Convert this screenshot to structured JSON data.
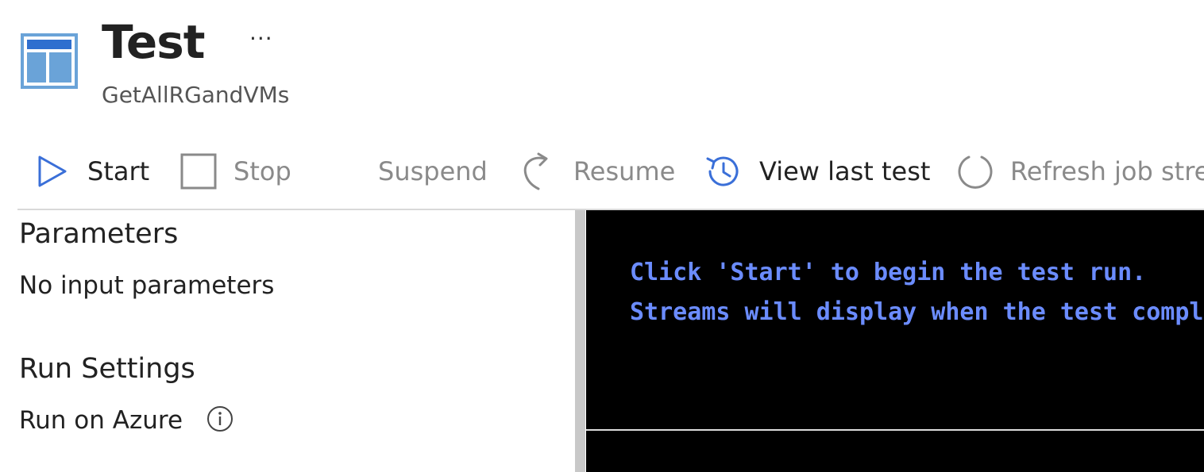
{
  "header": {
    "title": "Test",
    "more_label": "···",
    "subtitle": "GetAllRGandVMs"
  },
  "toolbar": {
    "start_label": "Start",
    "stop_label": "Stop",
    "suspend_label": "Suspend",
    "resume_label": "Resume",
    "view_last_test_label": "View last test",
    "refresh_label": "Refresh job streams"
  },
  "parameters": {
    "heading": "Parameters",
    "text": "No input parameters"
  },
  "run_settings": {
    "heading": "Run Settings",
    "text": "Run on Azure",
    "info_icon": "info-circle-icon"
  },
  "console": {
    "lines": [
      "Click 'Start' to begin the test run.",
      "Streams will display when the test completes."
    ]
  },
  "colors": {
    "accent": "#3a6fd8",
    "console_text": "#6b8cff",
    "console_bg": "#000000"
  }
}
